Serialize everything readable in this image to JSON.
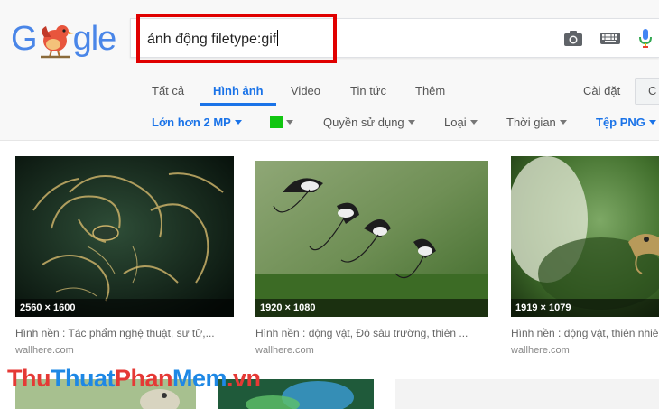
{
  "search": {
    "query": "ảnh động filetype:gif",
    "logo_letters": [
      "G",
      "gle"
    ]
  },
  "tabs": [
    {
      "label": "Tất cả",
      "active": false
    },
    {
      "label": "Hình ảnh",
      "active": true
    },
    {
      "label": "Video",
      "active": false
    },
    {
      "label": "Tin tức",
      "active": false
    },
    {
      "label": "Thêm",
      "active": false
    }
  ],
  "header_right": {
    "settings_label": "Cài đặt",
    "tools_label": "C"
  },
  "filters": [
    {
      "label": "Lớn hơn 2 MP",
      "highlighted": true
    },
    {
      "label": "",
      "highlighted": false,
      "swatch_color": "#11c611"
    },
    {
      "label": "Quyền sử dụng",
      "highlighted": false
    },
    {
      "label": "Loại",
      "highlighted": false
    },
    {
      "label": "Thời gian",
      "highlighted": false
    },
    {
      "label": "Tệp PNG",
      "highlighted": true
    }
  ],
  "results": [
    {
      "dimensions": "2560 × 1600",
      "caption": "Hình nền : Tác phẩm nghệ thuật, sư tử,...",
      "source": "wallhere.com"
    },
    {
      "dimensions": "1920 × 1080",
      "caption": "Hình nền : động vật, Độ sâu trường, thiên ...",
      "source": "wallhere.com"
    },
    {
      "dimensions": "1919 × 1079",
      "caption": "Hình nền : động vật, thiên nhiê",
      "source": "wallhere.com"
    }
  ],
  "watermark": {
    "part1": "Thu",
    "part2": "Thuat",
    "part3": "Phan",
    "part4": "Mem",
    "part5": ".vn"
  },
  "colors": {
    "accent_blue": "#1a73e8",
    "highlight_red": "#e00000",
    "watermark_red": "#e53935",
    "watermark_blue": "#1e88e5"
  }
}
